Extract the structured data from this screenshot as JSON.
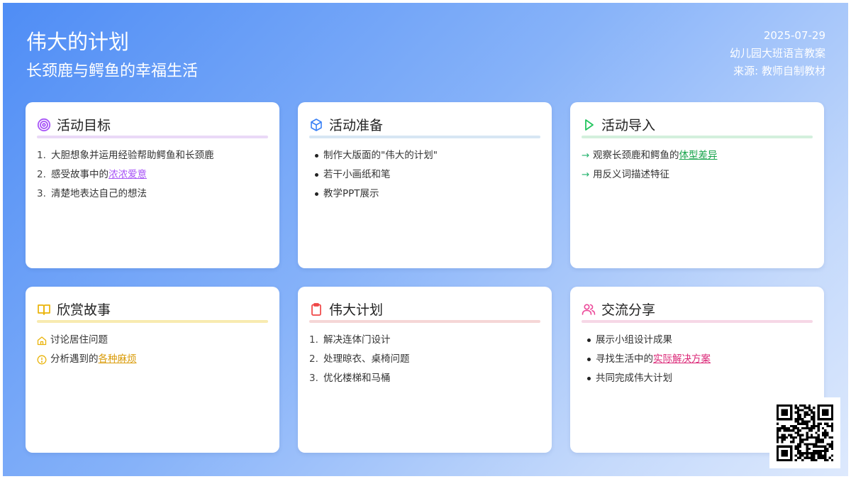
{
  "header": {
    "title": "伟大的计划",
    "subtitle": "长颈鹿与鳄鱼的幸福生活",
    "date": "2025-07-29",
    "category": "幼儿园大班语言教案",
    "source": "来源: 教师自制教材"
  },
  "colors": {
    "goals": "#a855f7",
    "prep": "#3b82f6",
    "intro": "#22c55e",
    "story": "#eab308",
    "plan": "#ef4444",
    "share": "#ec4899"
  },
  "cards": {
    "goals": {
      "title": "活动目标",
      "icon": "target-icon",
      "items": [
        {
          "num": "1.",
          "text": "大胆想象并运用经验帮助鳄鱼和长颈鹿",
          "hl": ""
        },
        {
          "num": "2.",
          "text": "感受故事中的",
          "hl": "浓浓爱意"
        },
        {
          "num": "3.",
          "text": "清楚地表达自己的想法",
          "hl": ""
        }
      ]
    },
    "prep": {
      "title": "活动准备",
      "icon": "box-icon",
      "items": [
        {
          "text": "制作大版面的\"伟大的计划\""
        },
        {
          "text": "若干小画纸和笔"
        },
        {
          "text": "教学PPT展示"
        }
      ]
    },
    "intro": {
      "title": "活动导入",
      "icon": "play-icon",
      "items": [
        {
          "arrow": "→",
          "text": "观察长颈鹿和鳄鱼的",
          "hl": "体型差异"
        },
        {
          "arrow": "→",
          "text": "用反义词描述特征",
          "hl": ""
        }
      ]
    },
    "story": {
      "title": "欣赏故事",
      "icon": "book-open-icon",
      "items": [
        {
          "icon": "home-icon",
          "text": "讨论居住问题",
          "hl": ""
        },
        {
          "icon": "alert-circle-icon",
          "text": "分析遇到的",
          "hl": "各种麻烦"
        }
      ]
    },
    "plan": {
      "title": "伟大计划",
      "icon": "clipboard-icon",
      "items": [
        {
          "num": "1.",
          "text": "解决连体门设计"
        },
        {
          "num": "2.",
          "text": "处理晾衣、桌椅问题"
        },
        {
          "num": "3.",
          "text": "优化楼梯和马桶"
        }
      ]
    },
    "share": {
      "title": "交流分享",
      "icon": "users-icon",
      "items": [
        {
          "text": "展示小组设计成果",
          "hl": ""
        },
        {
          "text": "寻找生活中的",
          "hl": "实际解决方案"
        },
        {
          "text": "共同完成伟大计划",
          "hl": ""
        }
      ]
    }
  }
}
